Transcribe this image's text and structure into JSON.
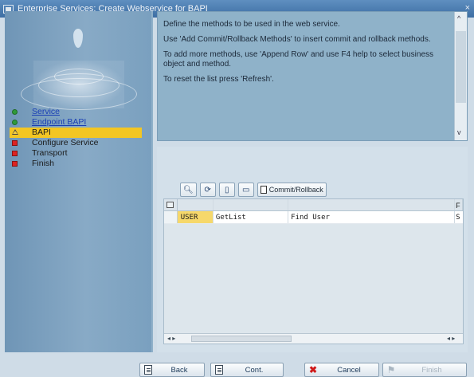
{
  "window": {
    "title": "Enterprise Services: Create Webservice for BAPI"
  },
  "wizard": {
    "steps": [
      {
        "label": "Service",
        "status": "done",
        "link": true
      },
      {
        "label": "Endpoint BAPI",
        "status": "done",
        "link": true
      },
      {
        "label": "BAPI",
        "status": "current",
        "link": false
      },
      {
        "label": "Configure Service",
        "status": "todo",
        "link": false
      },
      {
        "label": "Transport",
        "status": "todo",
        "link": false
      },
      {
        "label": "Finish",
        "status": "todo",
        "link": false
      }
    ]
  },
  "info": {
    "paragraphs": [
      "Define the methods to be used in the web service.",
      "Use 'Add Commit/Rollback Methods' to insert commit and rollback methods.",
      "To add more methods, use 'Append Row' and use F4 help to select business object and method.",
      "To reset the list press 'Refresh'."
    ]
  },
  "toolbar": {
    "commit_label": "Commit/Rollback"
  },
  "grid": {
    "header_tail": "F",
    "rows": [
      {
        "object": "USER",
        "method": "GetList",
        "description": "Find User",
        "tail": "S"
      }
    ]
  },
  "footer": {
    "back": "Back",
    "continue": "Cont.",
    "cancel": "Cancel",
    "finish": "Finish"
  }
}
